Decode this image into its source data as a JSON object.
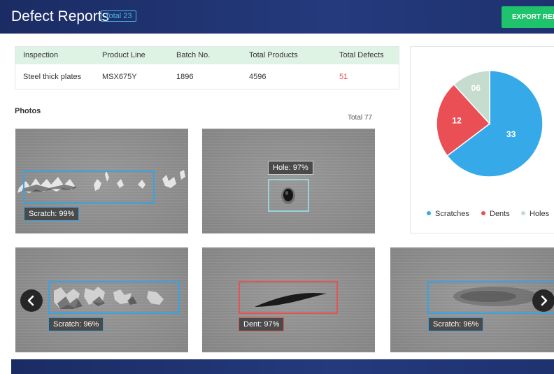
{
  "header": {
    "title": "Defect Reports",
    "total_badge": "Total  23",
    "export_label": "EXPORT REPO"
  },
  "summary_table": {
    "headers": [
      "Inspection",
      "Product Line",
      "Batch No.",
      "Total Products",
      "Total Defects"
    ],
    "row": [
      "Steel thick plates",
      "MSX675Y",
      "1896",
      "4596",
      "51"
    ],
    "defect_color": "#e25555"
  },
  "photos": {
    "title": "Photos",
    "total": "Total  77",
    "items": [
      {
        "label": "Scratch: 99%",
        "kind": "scratch"
      },
      {
        "label": "Hole: 97%",
        "kind": "hole"
      },
      {
        "label": "Scratch: 96%",
        "kind": "scratch"
      },
      {
        "label": "Dent: 97%",
        "kind": "dent"
      },
      {
        "label": "Scratch: 96%",
        "kind": "scratch"
      }
    ],
    "prev_icon": "chevron-left-icon",
    "next_icon": "chevron-right-icon"
  },
  "chart_data": {
    "type": "pie",
    "categories": [
      "Scratches",
      "Dents",
      "Holes"
    ],
    "values": [
      33,
      12,
      6
    ],
    "value_labels": [
      "33",
      "12",
      "06"
    ],
    "colors": [
      "#36a9e8",
      "#e94f55",
      "#c6dccf"
    ],
    "legend_position": "bottom"
  },
  "colors": {
    "header": "#1f3270",
    "accent_blue": "#36a9e8",
    "export_green": "#1fc36b"
  }
}
